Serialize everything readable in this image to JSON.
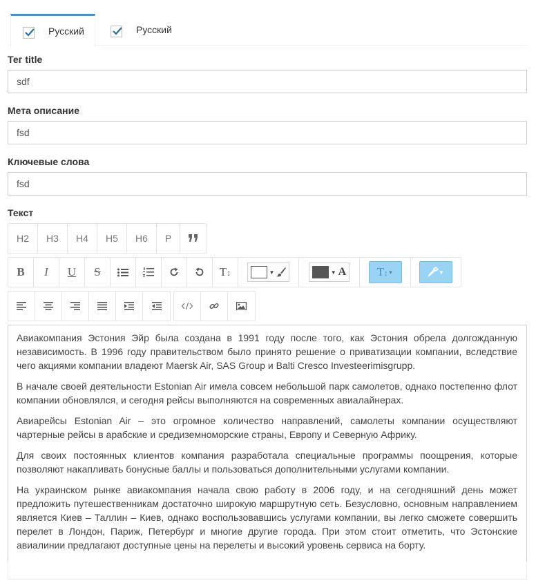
{
  "tabs": [
    {
      "label": "Русский",
      "checked": true
    },
    {
      "label": "Русский",
      "checked": true
    }
  ],
  "fields": {
    "title": {
      "label": "Тег title",
      "value": "sdf"
    },
    "meta_description": {
      "label": "Мета описание",
      "value": "fsd"
    },
    "keywords": {
      "label": "Ключевые слова",
      "value": "fsd"
    },
    "text": {
      "label": "Текст"
    }
  },
  "toolbar": {
    "headings": [
      "H2",
      "H3",
      "H4",
      "H5",
      "H6",
      "P"
    ],
    "icons": {
      "bold": "bold-icon",
      "italic": "italic-icon",
      "underline": "underline-icon",
      "strike": "strikethrough-icon",
      "ul": "unordered-list-icon",
      "ol": "ordered-list-icon",
      "redo": "redo-icon",
      "undo": "undo-icon",
      "font_size": "text-height-icon",
      "quote": "quote-icon",
      "align_left": "align-left-icon",
      "align_center": "align-center-icon",
      "align_right": "align-right-icon",
      "justify": "justify-icon",
      "indent": "indent-icon",
      "outdent": "outdent-icon",
      "code": "code-icon",
      "link": "link-icon",
      "image": "image-icon"
    },
    "bg_color": "#ffffff",
    "text_color": "#555555",
    "accent": "#9ad4f5"
  },
  "editor": {
    "paragraphs": [
      "Авиакомпания Эстония Эйр была создана в 1991 году после того, как Эстония обрела долгожданную независимость. В 1996 году правительством было принято решение о приватизации компании, вследствие чего акциями компании владеют Maersk Air, SAS Group и Balti Cresco Investeerimisgrupp.",
      "В начале своей деятельности Estonian Air имела совсем небольшой парк самолетов, однако постепенно флот компании обновлялся, и сегодня рейсы выполняются на современных авиалайнерах.",
      "Авиарейсы Estonian Air – это огромное количество направлений, самолеты компании осуществляют чартерные рейсы в арабские и средиземноморские страны, Европу и Северную Африку.",
      "Для своих постоянных клиентов компания разработала специальные программы поощрения, которые позволяют накапливать бонусные баллы и пользоваться дополнительными услугами компании.",
      "На украинском рынке авиакомпания начала свою работу в 2006 году, и на сегодняшний день может предложить путешественникам достаточно широкую маршрутную сеть. Безусловно, основным направлением является Киев – Таллин – Киев, однако воспользовавшись услугами компании, вы легко сможете совершить перелет в Лондон, Париж, Петербург и многие другие города.  При этом стоит отметить, что Эстонские авиалинии предлагают доступные цены на перелеты и высокий уровень сервиса на борту."
    ]
  }
}
